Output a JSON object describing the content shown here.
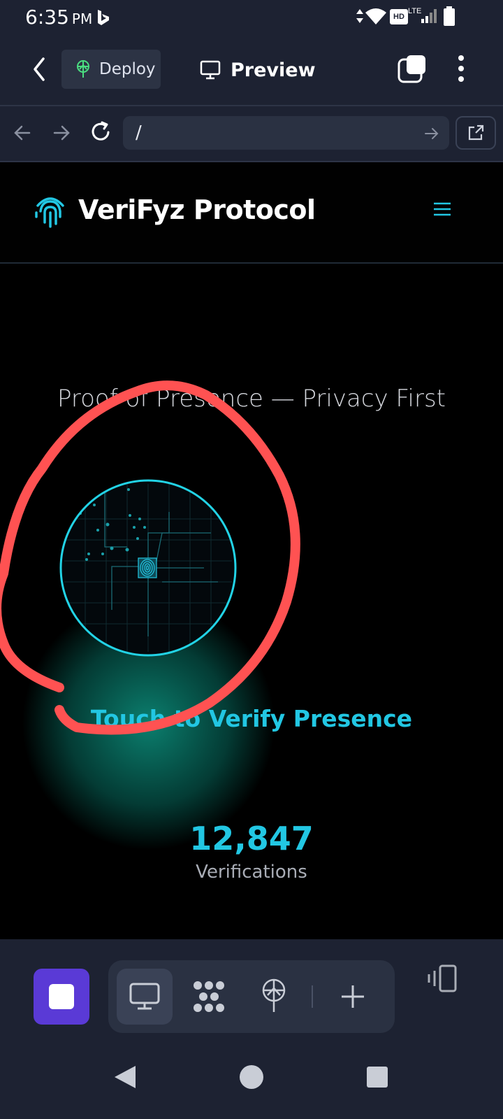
{
  "status_bar": {
    "time": "6:35",
    "ampm": "PM",
    "network": "LTE",
    "hd_badge": "HD"
  },
  "app_header": {
    "deploy_label": "Deploy",
    "preview_label": "Preview"
  },
  "url_bar": {
    "path": "/"
  },
  "site": {
    "brand": "VeriFyz Protocol",
    "tagline": "Proof of Presence — Privacy First",
    "cta": "Touch to Verify Presence",
    "stat_value": "12,847",
    "stat_label": "Verifications"
  },
  "colors": {
    "accent": "#22c7e3",
    "glow": "#14e6c8",
    "annotation": "#ff5252",
    "stop_button": "#5a3ad6",
    "chrome_bg": "#1d2232"
  }
}
